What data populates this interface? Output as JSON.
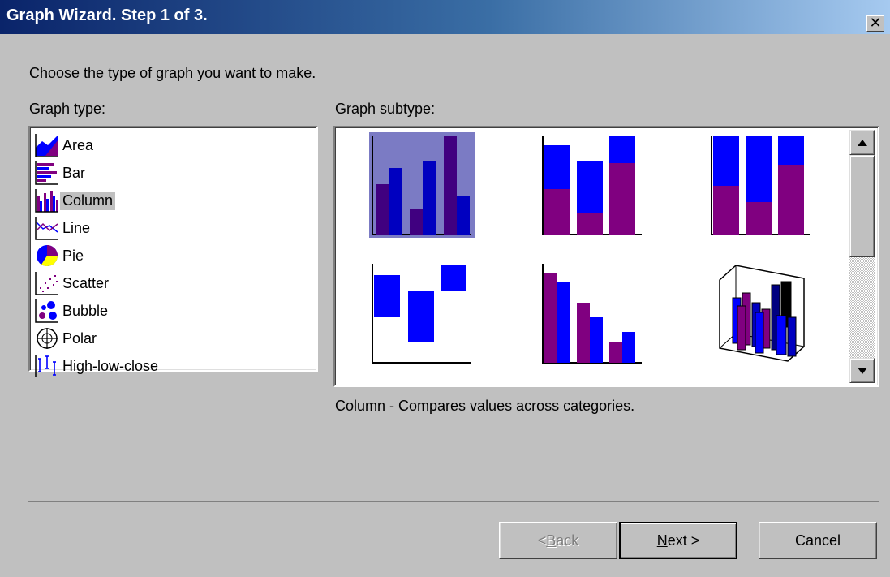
{
  "window": {
    "title": "Graph Wizard. Step 1 of 3.",
    "close_label": "✕"
  },
  "instructions": "Choose the type of graph you want to make.",
  "graph_type": {
    "label": "Graph type:",
    "items": [
      {
        "label": "Area",
        "icon": "area-chart-icon"
      },
      {
        "label": "Bar",
        "icon": "bar-chart-icon"
      },
      {
        "label": "Column",
        "icon": "column-chart-icon",
        "selected": true
      },
      {
        "label": "Line",
        "icon": "line-chart-icon"
      },
      {
        "label": "Pie",
        "icon": "pie-chart-icon"
      },
      {
        "label": "Scatter",
        "icon": "scatter-chart-icon"
      },
      {
        "label": "Bubble",
        "icon": "bubble-chart-icon"
      },
      {
        "label": "Polar",
        "icon": "polar-chart-icon"
      },
      {
        "label": "High-low-close",
        "icon": "high-low-close-icon"
      }
    ]
  },
  "graph_subtype": {
    "label": "Graph subtype:",
    "selected_index": 0,
    "items": [
      {
        "icon": "clustered-column-icon"
      },
      {
        "icon": "stacked-column-icon"
      },
      {
        "icon": "percent-stacked-column-icon"
      },
      {
        "icon": "floating-column-icon"
      },
      {
        "icon": "side-by-side-column-icon"
      },
      {
        "icon": "3d-column-icon"
      }
    ],
    "description": "Column - Compares values across categories."
  },
  "buttons": {
    "back": {
      "prefix": "< ",
      "mnemonic": "B",
      "rest": "ack",
      "enabled": false
    },
    "next": {
      "mnemonic": "N",
      "rest": "ext >",
      "default": true
    },
    "cancel": {
      "label": "Cancel"
    }
  },
  "colors": {
    "title_gradient_start": "#0a246a",
    "title_gradient_end": "#a6caf0",
    "dialog_face": "#c0c0c0",
    "series_purple": "#800080",
    "series_blue": "#0000ff",
    "selection": "#7b7bc4"
  }
}
